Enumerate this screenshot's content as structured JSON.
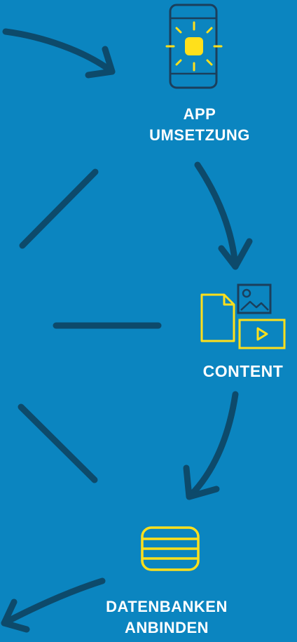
{
  "steps": {
    "app": {
      "line1": "APP",
      "line2": "UMSETZUNG",
      "icon": "phone-sun-icon"
    },
    "content": {
      "label": "CONTENT",
      "icon": "media-files-icon"
    },
    "database": {
      "line1": "DATENBANKEN",
      "line2": "ANBINDEN",
      "icon": "database-icon"
    }
  },
  "colors": {
    "background": "#0b85c0",
    "arrow": "#0d4a6b",
    "text": "#ffffff",
    "icon_outline": "#1b3f5c",
    "icon_accent": "#ffe01b"
  }
}
